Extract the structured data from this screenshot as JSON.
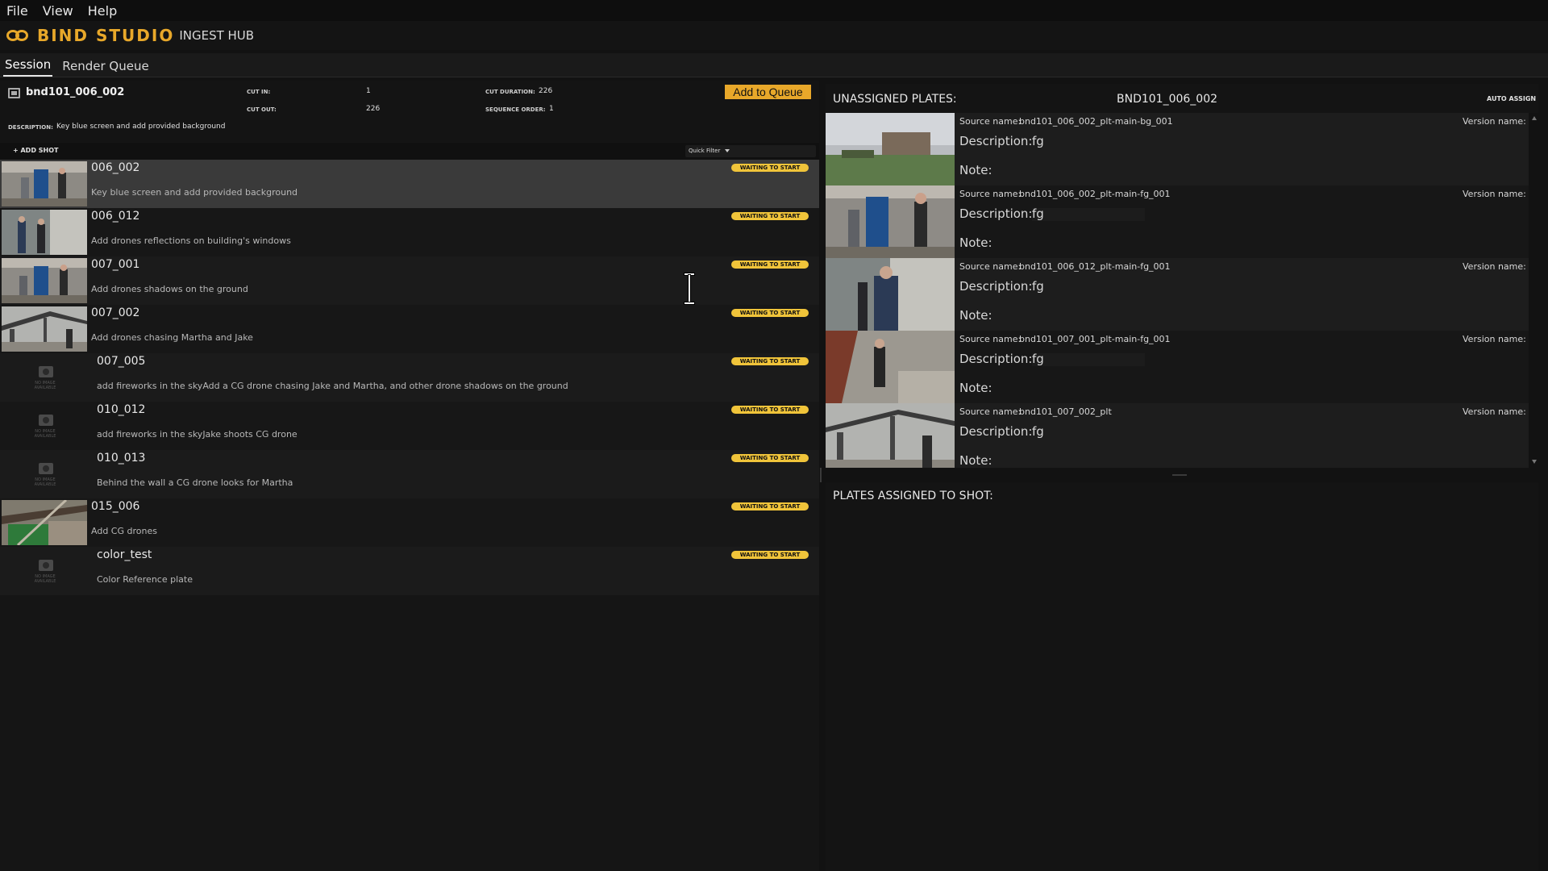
{
  "menu": {
    "items": [
      "File",
      "View",
      "Help"
    ]
  },
  "app": {
    "brand": "BIND STUDIO",
    "subtitle": "INGEST HUB",
    "accent": "#e8a82a"
  },
  "tabs": [
    {
      "label": "Session",
      "active": true
    },
    {
      "label": "Render Queue",
      "active": false
    }
  ],
  "shot_detail": {
    "name": "bnd101_006_002",
    "cut_in_label": "CUT IN:",
    "cut_in": "1",
    "cut_out_label": "CUT OUT:",
    "cut_out": "226",
    "cut_duration_label": "CUT DURATION:",
    "cut_duration": "226",
    "sequence_order_label": "SEQUENCE ORDER:",
    "sequence_order": "1",
    "description_label": "DESCRIPTION:",
    "description": "Key blue screen and add provided background",
    "add_queue_label": "Add to Queue"
  },
  "toolbar": {
    "add_shot_label": "+ ADD SHOT",
    "quick_filter_label": "Quick Filter"
  },
  "no_image_text": "NO IMAGE AVAILABLE",
  "shots": [
    {
      "code": "006_002",
      "description": "Key blue screen and add provided background",
      "status": "WAITING TO START",
      "has_thumb": true
    },
    {
      "code": "006_012",
      "description": "Add drones reflections on building's windows",
      "status": "WAITING TO START",
      "has_thumb": true
    },
    {
      "code": "007_001",
      "description": "Add drones shadows on the ground",
      "status": "WAITING TO START",
      "has_thumb": true
    },
    {
      "code": "007_002",
      "description": "Add drones chasing Martha and Jake",
      "status": "WAITING TO START",
      "has_thumb": true
    },
    {
      "code": "007_005",
      "description": "add fireworks in the skyAdd a CG drone chasing Jake and Martha, and other drone shadows on the ground",
      "status": "WAITING TO START",
      "has_thumb": false
    },
    {
      "code": "010_012",
      "description": "add fireworks in the skyJake shoots CG drone",
      "status": "WAITING TO START",
      "has_thumb": false
    },
    {
      "code": "010_013",
      "description": "Behind the wall a CG drone looks for Martha",
      "status": "WAITING TO START",
      "has_thumb": false
    },
    {
      "code": "015_006",
      "description": "Add CG drones",
      "status": "WAITING TO START",
      "has_thumb": true
    },
    {
      "code": "color_test",
      "description": "Color Reference plate",
      "status": "WAITING TO START",
      "has_thumb": false
    }
  ],
  "unassigned": {
    "title": "UNASSIGNED PLATES:",
    "shot": "BND101_006_002",
    "auto_assign_label": "AUTO ASSIGN",
    "source_label": "Source name:",
    "version_label": "Version name:",
    "description_label": "Description:",
    "note_label": "Note:",
    "plates": [
      {
        "source": "bnd101_006_002_plt-main-bg_001",
        "description": "fg"
      },
      {
        "source": "bnd101_006_002_plt-main-fg_001",
        "description": "fg"
      },
      {
        "source": "bnd101_006_012_plt-main-fg_001",
        "description": "fg"
      },
      {
        "source": "bnd101_007_001_plt-main-fg_001",
        "description": "fg"
      },
      {
        "source": "bnd101_007_002_plt",
        "description": "fg"
      }
    ]
  },
  "assigned": {
    "title": "PLATES ASSIGNED TO SHOT:"
  },
  "colors": {
    "status_badge": "#f0c43a",
    "selected_row": "#3a3a3a",
    "background": "#121212"
  }
}
